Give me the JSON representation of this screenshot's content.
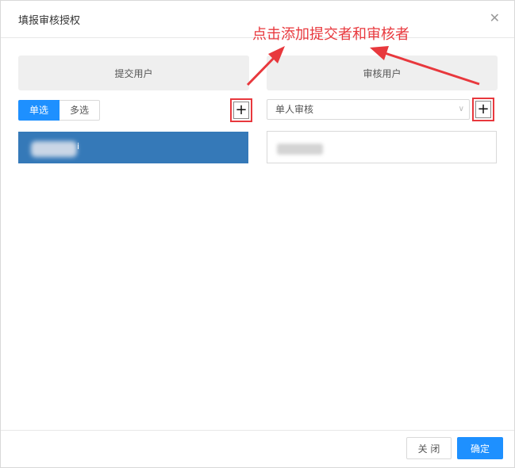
{
  "dialog": {
    "title": "填报审核授权",
    "close_icon": "close-icon"
  },
  "annotation": {
    "text": "点击添加提交者和审核者",
    "color": "#e8383d"
  },
  "left_panel": {
    "header": "提交用户",
    "segment": {
      "single_label": "单选",
      "multi_label": "多选",
      "selected": "单选"
    },
    "add_icon": "+",
    "list_item": "i"
  },
  "right_panel": {
    "header": "审核用户",
    "select": {
      "value": "单人审核"
    },
    "add_icon": "+"
  },
  "footer": {
    "close_label": "关 闭",
    "confirm_label": "确定"
  },
  "colors": {
    "accent": "#1e90ff",
    "selected_row": "#3579b8",
    "annotation": "#e8383d"
  }
}
